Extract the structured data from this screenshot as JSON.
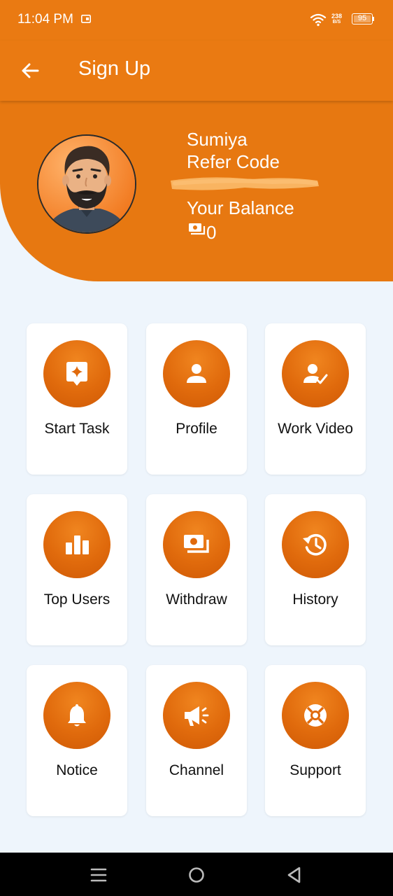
{
  "status_bar": {
    "time": "11:04 PM",
    "speed_value": "238",
    "speed_unit": "B/S",
    "battery": "95"
  },
  "app_bar": {
    "title": "Sign Up",
    "back_icon": "arrow-left-icon"
  },
  "profile": {
    "name": "Sumiya",
    "refer_label": "Refer Code",
    "refer_code": "",
    "balance_label": "Your Balance",
    "balance_value": "0",
    "balance_icon": "money-icon"
  },
  "menu": {
    "items": [
      {
        "label": "Start Task",
        "icon": "sparkle-chat-icon"
      },
      {
        "label": "Profile",
        "icon": "person-icon"
      },
      {
        "label": "Work Video",
        "icon": "person-check-icon"
      },
      {
        "label": "Top Users",
        "icon": "bar-chart-icon"
      },
      {
        "label": "Withdraw",
        "icon": "money-icon"
      },
      {
        "label": "History",
        "icon": "history-icon"
      },
      {
        "label": "Notice",
        "icon": "bell-icon"
      },
      {
        "label": "Channel",
        "icon": "megaphone-icon"
      },
      {
        "label": "Support",
        "icon": "lifebuoy-icon"
      }
    ]
  },
  "colors": {
    "primary": "#ea7a12",
    "icon_circle": "#e06a0c",
    "background": "#eef5fc",
    "card": "#ffffff"
  },
  "nav_bar": {
    "icons": [
      "menu-icon",
      "home-circle-icon",
      "back-triangle-icon"
    ]
  }
}
